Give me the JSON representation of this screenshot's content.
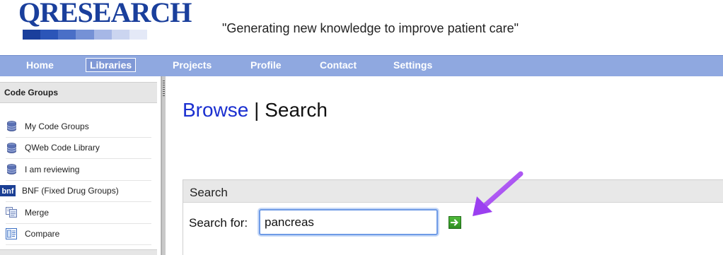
{
  "header": {
    "logo_text": "QRESEARCH",
    "logo_bar_colors": [
      "#1a3f9c",
      "#2b55b8",
      "#4a6fc7",
      "#7591d6",
      "#a6b7e6",
      "#cbd5f0",
      "#e4e9f7"
    ],
    "tagline": "\"Generating new knowledge to improve patient care\""
  },
  "nav": {
    "items": [
      {
        "label": "Home"
      },
      {
        "label": "Libraries",
        "active": true
      },
      {
        "label": "Projects"
      },
      {
        "label": "Profile"
      },
      {
        "label": "Contact"
      },
      {
        "label": "Settings"
      }
    ]
  },
  "sidebar": {
    "title": "Code Groups",
    "items": [
      {
        "label": "My Code Groups",
        "icon": "database-icon"
      },
      {
        "label": "QWeb Code Library",
        "icon": "database-icon"
      },
      {
        "label": "I am reviewing",
        "icon": "database-icon"
      },
      {
        "label": "BNF (Fixed Drug Groups)",
        "icon": "bnf-icon",
        "icon_text": "bnf"
      },
      {
        "label": "Merge",
        "icon": "merge-icon"
      },
      {
        "label": "Compare",
        "icon": "compare-icon"
      }
    ]
  },
  "main": {
    "title_browse": "Browse",
    "title_sep": " | ",
    "title_search": "Search",
    "search_panel": {
      "heading": "Search",
      "label": "Search for:",
      "value": "pancreas"
    }
  },
  "colors": {
    "nav_bg": "#8fa8e0",
    "link_blue": "#1a2fd0",
    "annotation_arrow": "#a64bf4",
    "go_button": "#3aa52c"
  }
}
